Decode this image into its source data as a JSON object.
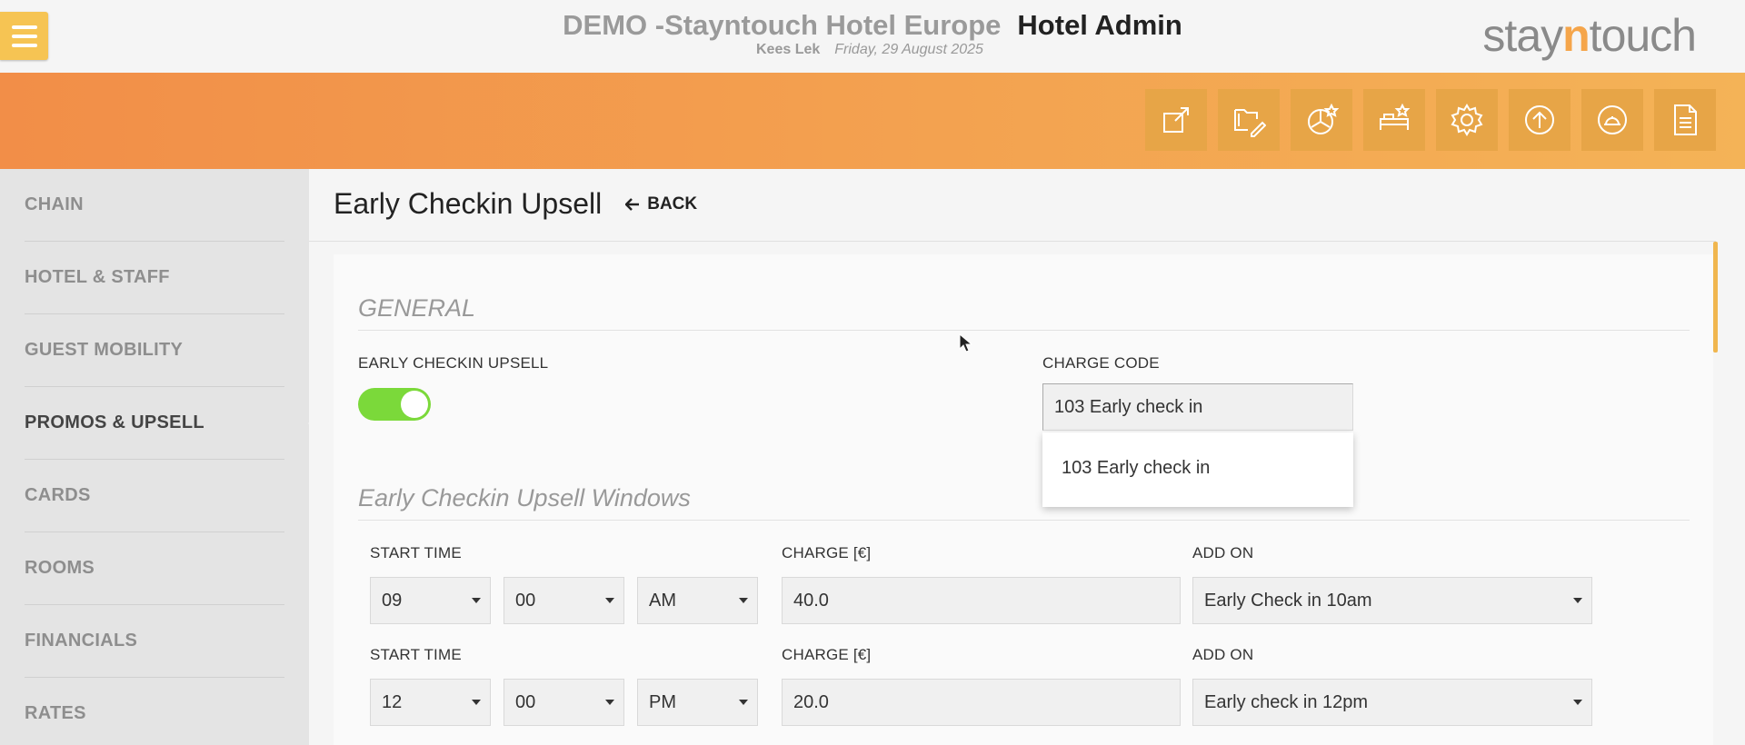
{
  "header": {
    "hotel_name": "DEMO -Stayntouch Hotel Europe",
    "app_name": "Hotel Admin",
    "user": "Kees Lek",
    "date": "Friday, 29 August 2025",
    "logo_prefix": "stay",
    "logo_n": "n",
    "logo_suffix": "touch"
  },
  "toolbar": [
    {
      "icon": "external-link-icon"
    },
    {
      "icon": "folder-edit-icon"
    },
    {
      "icon": "chart-star-icon"
    },
    {
      "icon": "bed-star-icon"
    },
    {
      "icon": "gear-icon"
    },
    {
      "icon": "upload-circle-icon"
    },
    {
      "icon": "bell-circle-icon"
    },
    {
      "icon": "document-icon"
    }
  ],
  "sidebar": {
    "items": [
      {
        "label": "CHAIN"
      },
      {
        "label": "HOTEL & STAFF"
      },
      {
        "label": "GUEST MOBILITY"
      },
      {
        "label": "PROMOS & UPSELL",
        "active": true
      },
      {
        "label": "CARDS"
      },
      {
        "label": "ROOMS"
      },
      {
        "label": "FINANCIALS"
      },
      {
        "label": "RATES"
      }
    ]
  },
  "page": {
    "title": "Early Checkin Upsell",
    "back_label": "BACK"
  },
  "general": {
    "section_title": "GENERAL",
    "toggle_label": "EARLY CHECKIN UPSELL",
    "toggle_on": true,
    "charge_code_label": "CHARGE CODE",
    "charge_code_value": "103 Early check in",
    "charge_code_options": [
      "103 Early check in"
    ]
  },
  "windows": {
    "section_title": "Early Checkin Upsell Windows",
    "rows": [
      {
        "start_label": "START TIME",
        "hour": "09",
        "minute": "00",
        "ampm": "AM",
        "charge_label": "CHARGE [€]",
        "charge": "40.0",
        "addon_label": "ADD ON",
        "addon": "Early Check in 10am"
      },
      {
        "start_label": "START TIME",
        "hour": "12",
        "minute": "00",
        "ampm": "PM",
        "charge_label": "CHARGE [€]",
        "charge": "20.0",
        "addon_label": "ADD ON",
        "addon": "Early check in 12pm"
      }
    ]
  },
  "colors": {
    "accent_orange": "#f28e48",
    "accent_yellow": "#f4b357",
    "toggle_green": "#7bd93a"
  }
}
